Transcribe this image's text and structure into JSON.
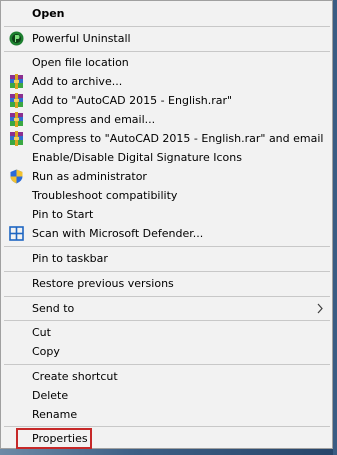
{
  "menu": {
    "open": "Open",
    "powerful_uninstall": "Powerful Uninstall",
    "open_file_location": "Open file location",
    "add_to_archive": "Add to archive...",
    "add_to_rar": "Add to \"AutoCAD 2015 - English.rar\"",
    "compress_email": "Compress and email...",
    "compress_to_rar_email": "Compress to \"AutoCAD 2015 - English.rar\" and email",
    "digital_signature": "Enable/Disable Digital Signature Icons",
    "run_as_admin": "Run as administrator",
    "troubleshoot": "Troubleshoot compatibility",
    "pin_to_start": "Pin to Start",
    "scan_defender": "Scan with Microsoft Defender...",
    "pin_to_taskbar": "Pin to taskbar",
    "restore_versions": "Restore previous versions",
    "send_to": "Send to",
    "cut": "Cut",
    "copy": "Copy",
    "create_shortcut": "Create shortcut",
    "delete": "Delete",
    "rename": "Rename",
    "properties": "Properties"
  },
  "icons": {
    "powerful_uninstall": "powerful-uninstall-icon",
    "winrar": "winrar-icon",
    "shield": "uac-shield-icon",
    "defender": "defender-icon",
    "submenu": "chevron-right-icon"
  },
  "colors": {
    "menu_bg": "#f2f2f2",
    "highlight": "#c62828"
  }
}
